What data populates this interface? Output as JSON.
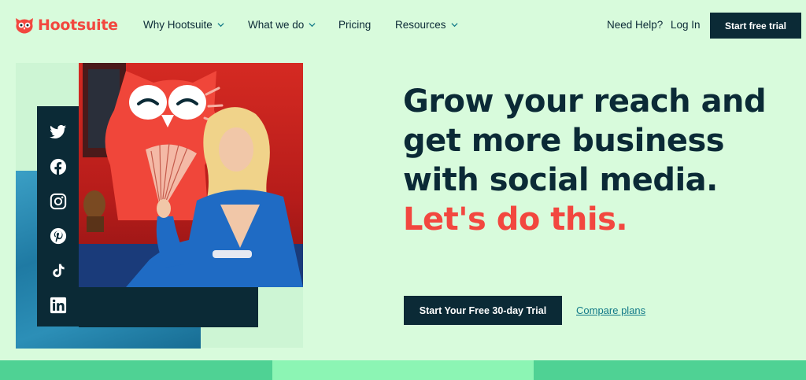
{
  "nav": {
    "brand": "Hootsuite",
    "items": [
      {
        "label": "Why Hootsuite",
        "has_dropdown": true
      },
      {
        "label": "What we do",
        "has_dropdown": true
      },
      {
        "label": "Pricing",
        "has_dropdown": false
      },
      {
        "label": "Resources",
        "has_dropdown": true
      }
    ],
    "help": "Need Help?",
    "login": "Log In",
    "trial_button": "Start free trial"
  },
  "hero": {
    "headline": "Grow your reach and get more business with social media.",
    "headline_accent": "Let's do this.",
    "cta": "Start Your Free 30-day Trial",
    "secondary_link": "Compare plans"
  },
  "social_icons": [
    "twitter-icon",
    "facebook-icon",
    "instagram-icon",
    "pinterest-icon",
    "tiktok-icon",
    "linkedin-icon"
  ],
  "colors": {
    "background": "#d8fbdc",
    "brand_red": "#f2473f",
    "navy": "#0b2a36",
    "link_teal": "#127a88"
  }
}
